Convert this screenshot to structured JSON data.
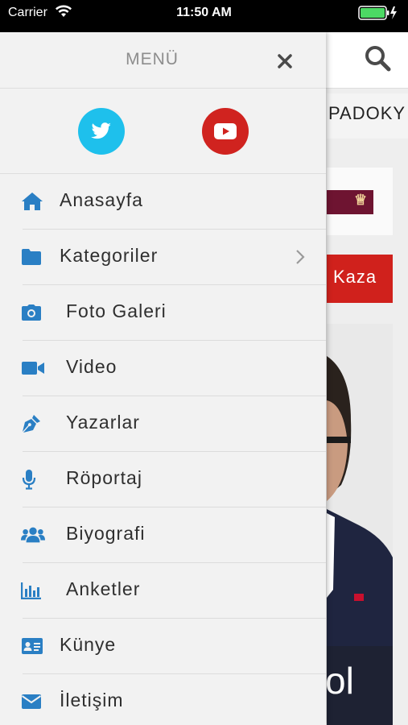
{
  "status_bar": {
    "carrier": "Carrier",
    "time": "11:50 AM"
  },
  "background": {
    "marquee_text": "PADOKY",
    "tag_text": "Kaza",
    "photo_text": "ol"
  },
  "drawer": {
    "title": "MENÜ",
    "social": [
      "twitter-icon",
      "youtube-icon"
    ],
    "items": [
      {
        "label": "Anasayfa",
        "icon": "home-icon",
        "has_chevron": false
      },
      {
        "label": "Kategoriler",
        "icon": "folder-icon",
        "has_chevron": true
      },
      {
        "label": "Foto Galeri",
        "icon": "camera-icon",
        "has_chevron": false
      },
      {
        "label": "Video",
        "icon": "video-camera-icon",
        "has_chevron": false
      },
      {
        "label": "Yazarlar",
        "icon": "pen-nib-icon",
        "has_chevron": false
      },
      {
        "label": "Röportaj",
        "icon": "microphone-icon",
        "has_chevron": false
      },
      {
        "label": "Biyografi",
        "icon": "users-icon",
        "has_chevron": false
      },
      {
        "label": "Anketler",
        "icon": "bar-chart-icon",
        "has_chevron": false
      },
      {
        "label": "Künye",
        "icon": "id-card-icon",
        "has_chevron": false
      },
      {
        "label": "İletişim",
        "icon": "envelope-icon",
        "has_chevron": false
      }
    ]
  },
  "colors": {
    "icon_blue": "#2a7fc4",
    "twitter": "#1ec0ec",
    "youtube": "#d0231f",
    "drawer_bg": "#f2f2f2"
  }
}
